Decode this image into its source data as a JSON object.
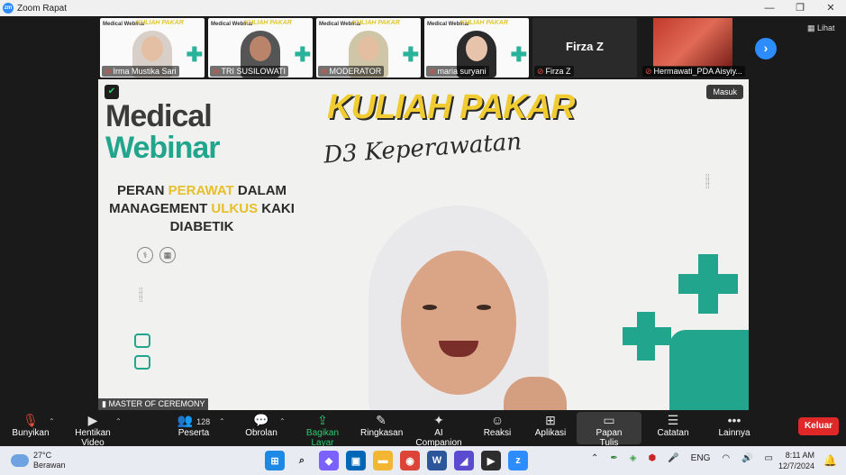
{
  "window": {
    "title": "Zoom Rapat"
  },
  "participants": [
    {
      "name": "Irma Mustika Sari"
    },
    {
      "name": "TRI SUSILOWATI"
    },
    {
      "name": "MODERATOR"
    },
    {
      "name": "maria suryani"
    },
    {
      "name": "Firza Z"
    },
    {
      "name": "Hermawati_PDA Aisyiy..."
    }
  ],
  "thumb_slide": {
    "t1": "Medical Webinar",
    "t2": "KULIAH PAKAR"
  },
  "view_label": "Lihat",
  "share": {
    "masuk": "Masuk",
    "medical": "Medical",
    "webinar": "Webinar",
    "kuliah": "KULIAH PAKAR",
    "d3": "D3 Keperawatan",
    "peran_a": "PERAN ",
    "peran_b": "PERAWAT",
    "peran_c": " DALAM",
    "line2_a": "MANAGEMENT ",
    "line2_b": "ULKUS",
    "line2_c": " KAKI",
    "line3": "DIABETIK",
    "speaker_label": "MASTER OF CEREMONY"
  },
  "toolbar": {
    "mute": "Bunyikan",
    "video": "Hentikan Video",
    "participants": "Peserta",
    "participants_count": "128",
    "chat": "Obrolan",
    "share": "Bagikan Layar",
    "summary": "Ringkasan",
    "ai": "AI Companion",
    "reactions": "Reaksi",
    "apps": "Aplikasi",
    "whiteboard": "Papan Tulis",
    "notes": "Catatan",
    "more": "Lainnya",
    "leave": "Keluar"
  },
  "taskbar": {
    "temp": "27°C",
    "weather": "Berawan",
    "lang": "ENG",
    "time": "8:11 AM",
    "date": "12/7/2024"
  }
}
